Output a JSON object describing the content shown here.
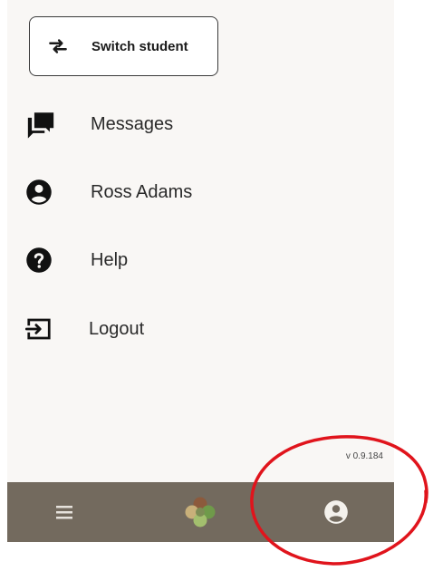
{
  "switch_student": {
    "label": "Switch student",
    "icon": "swap-arrows-icon"
  },
  "menu": {
    "items": [
      {
        "label": "Messages",
        "icon": "messages-icon"
      },
      {
        "label": "Ross Adams",
        "icon": "account-icon"
      },
      {
        "label": "Help",
        "icon": "help-icon"
      },
      {
        "label": "Logout",
        "icon": "logout-icon"
      }
    ]
  },
  "footer": {
    "version": "v 0.9.184"
  },
  "bottom_bar": {
    "items": [
      {
        "icon": "hamburger-menu-icon"
      },
      {
        "icon": "app-logo-icon"
      },
      {
        "icon": "account-icon"
      }
    ]
  },
  "colors": {
    "background": "#f9f7f5",
    "bottom_bar": "#736a5e",
    "annotation": "#e0141c",
    "text": "#2a2a2a"
  }
}
